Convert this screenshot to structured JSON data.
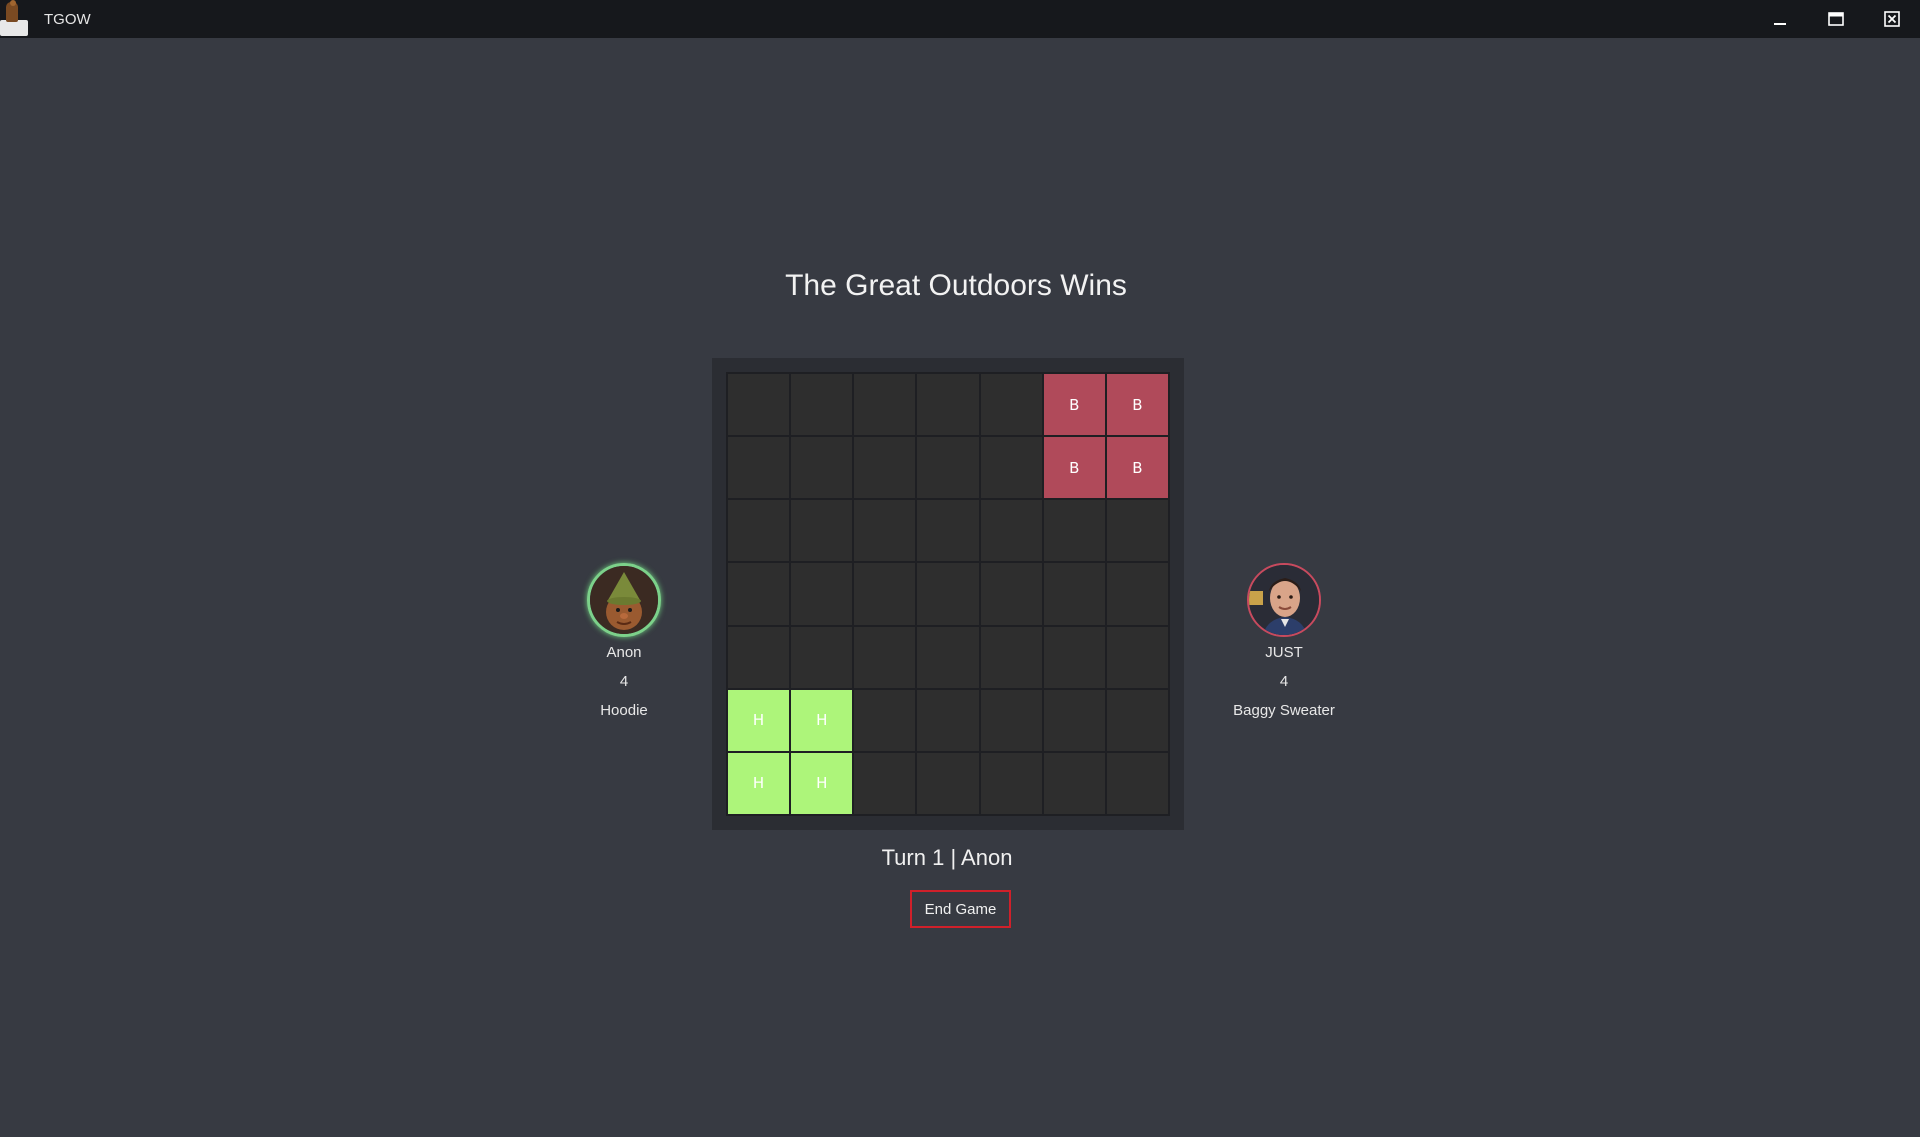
{
  "window": {
    "title": "TGOW",
    "controls": [
      "minimize-icon",
      "maximize-icon",
      "close-icon"
    ]
  },
  "game": {
    "title": "The Great Outdoors Wins",
    "board": {
      "rows": 7,
      "cols": 7,
      "cells": [
        [
          "",
          "",
          "",
          "",
          "",
          "B",
          "B"
        ],
        [
          "",
          "",
          "",
          "",
          "",
          "B",
          "B"
        ],
        [
          "",
          "",
          "",
          "",
          "",
          "",
          ""
        ],
        [
          "",
          "",
          "",
          "",
          "",
          "",
          ""
        ],
        [
          "",
          "",
          "",
          "",
          "",
          "",
          ""
        ],
        [
          "H",
          "H",
          "",
          "",
          "",
          "",
          ""
        ],
        [
          "H",
          "H",
          "",
          "",
          "",
          "",
          ""
        ]
      ]
    },
    "turn_label": "Turn 1 | Anon",
    "end_button": "End Game"
  },
  "players": [
    {
      "name": "Anon",
      "score": "4",
      "item": "Hoodie",
      "ring_color": "#7cd18a",
      "tile_color": "#adf57a"
    },
    {
      "name": "JUST",
      "score": "4",
      "item": "Baggy Sweater",
      "ring_color": "#c84a5e",
      "tile_color": "#b04a5a"
    }
  ]
}
